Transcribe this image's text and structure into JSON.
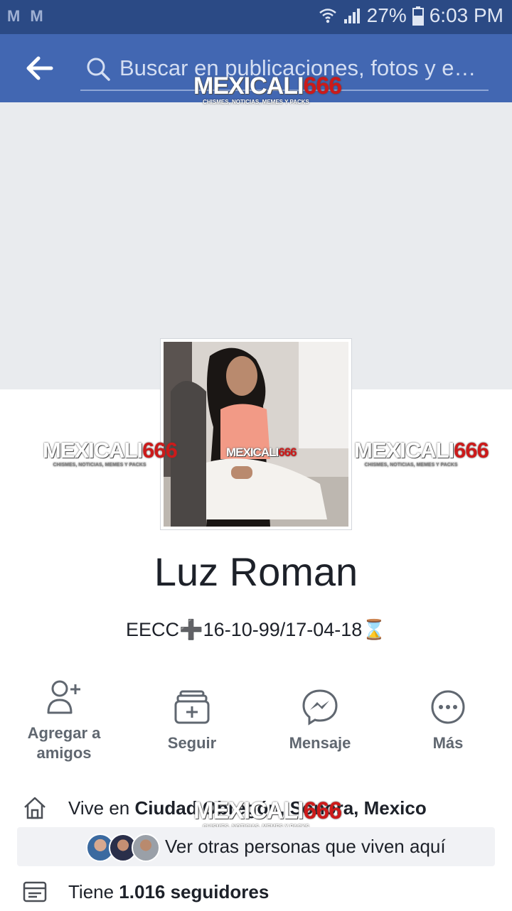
{
  "status_bar": {
    "notif_icons": [
      "M",
      "M"
    ],
    "battery": "27%",
    "time": "6:03 PM"
  },
  "app_bar": {
    "search_placeholder": "Buscar en publicaciones, fotos y e…"
  },
  "profile": {
    "name": "Luz Roman",
    "bio": "EECC➕16-10-99/17-04-18⌛"
  },
  "actions": [
    {
      "label": "Agregar a amigos",
      "icon": "add-friend-icon"
    },
    {
      "label": "Seguir",
      "icon": "follow-icon"
    },
    {
      "label": "Mensaje",
      "icon": "messenger-icon"
    },
    {
      "label": "Más",
      "icon": "more-icon"
    }
  ],
  "intro": {
    "lives_prefix": "Vive en ",
    "lives_place": "Ciudad Obregón, Sonora, Mexico",
    "see_others": "Ver otras personas que viven aquí",
    "followers_prefix": "Tiene ",
    "followers_count": "1.016 seguidores"
  },
  "watermark": {
    "brand_a": "MEXICALI",
    "brand_b": "666",
    "tagline": "CHISMES, NOTICIAS, MEMES Y PACKS"
  },
  "colors": {
    "app_bar": "#4267b2",
    "status_bar": "#2b4a85",
    "cover": "#e9ebee",
    "watermark_red": "#cc1a1a"
  }
}
